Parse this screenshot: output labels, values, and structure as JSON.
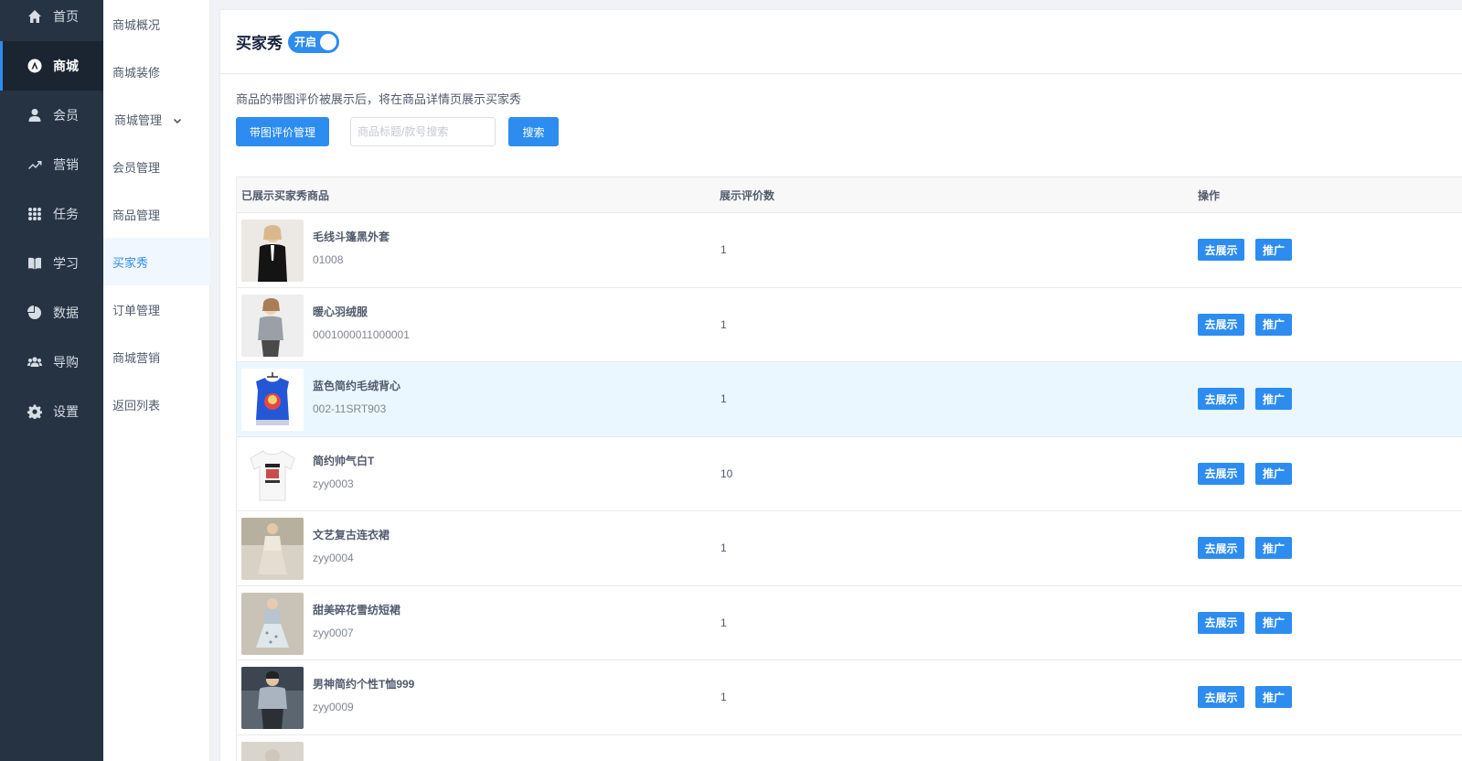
{
  "nav": [
    {
      "label": "首页",
      "icon": "home-icon"
    },
    {
      "label": "商城",
      "icon": "mall-icon"
    },
    {
      "label": "会员",
      "icon": "user-icon"
    },
    {
      "label": "营销",
      "icon": "trend-icon"
    },
    {
      "label": "任务",
      "icon": "grid-icon"
    },
    {
      "label": "学习",
      "icon": "book-icon"
    },
    {
      "label": "数据",
      "icon": "pie-icon"
    },
    {
      "label": "导购",
      "icon": "team-icon"
    },
    {
      "label": "设置",
      "icon": "gear-icon"
    }
  ],
  "subnav": [
    "商城概况",
    "商城装修",
    "商城管理",
    "会员管理",
    "商品管理",
    "买家秀",
    "订单管理",
    "商城营销",
    "返回列表"
  ],
  "header": {
    "title": "买家秀",
    "toggle_label": "开启"
  },
  "tip": "商品的带图评价被展示后，将在商品详情页展示买家秀",
  "toolbar": {
    "manage_button": "带图评价管理",
    "search_placeholder": "商品标题/款号搜索",
    "search_button": "搜索"
  },
  "table": {
    "headers": [
      "已展示买家秀商品",
      "展示评价数",
      "操作"
    ],
    "show_label": "去展示",
    "promo_label": "推广",
    "rows": [
      {
        "name": "毛线斗篷黑外套",
        "code": "01008",
        "count": "1"
      },
      {
        "name": "暖心羽绒服",
        "code": "0001000011000001",
        "count": "1"
      },
      {
        "name": "蓝色简约毛绒背心",
        "code": "002-11SRT903",
        "count": "1"
      },
      {
        "name": "简约帅气白T",
        "code": "zyy0003",
        "count": "10"
      },
      {
        "name": "文艺复古连衣裙",
        "code": "zyy0004",
        "count": "1"
      },
      {
        "name": "甜美碎花雪纺短裙",
        "code": "zyy0007",
        "count": "1"
      },
      {
        "name": "男神简约个性T恤999",
        "code": "zyy0009",
        "count": "1"
      }
    ]
  },
  "colors": {
    "accent": "#2d8cf0",
    "sidebar": "#263342",
    "sidebar_active": "#1b2531"
  }
}
